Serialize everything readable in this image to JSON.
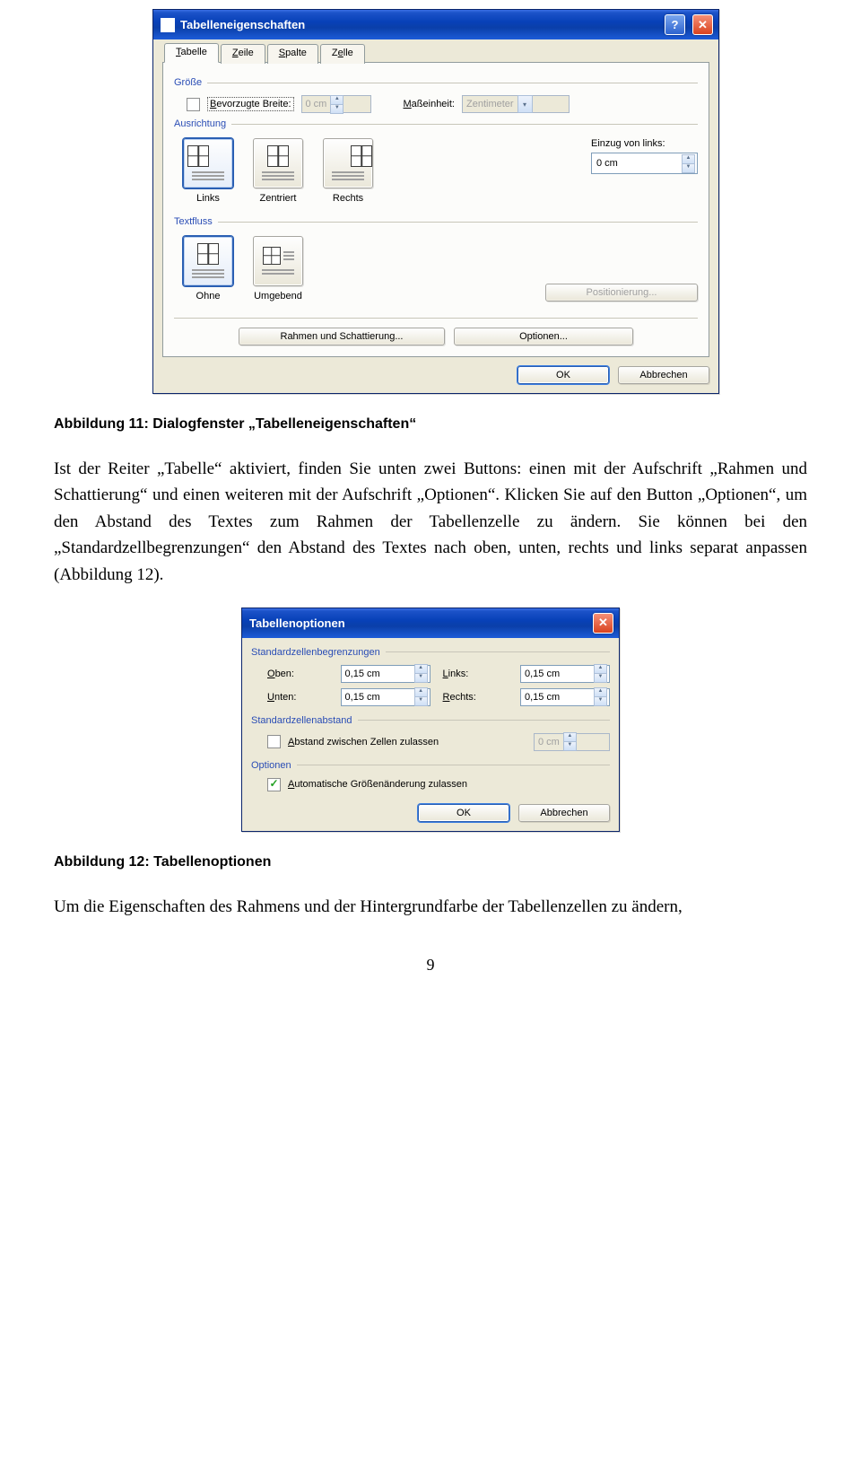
{
  "dialog1": {
    "title": "Tabelleneigenschaften",
    "tabs": [
      "Tabelle",
      "Zeile",
      "Spalte",
      "Zelle"
    ],
    "size": {
      "group_label": "Größe",
      "checkbox_label_pre": "B",
      "checkbox_label_rest": "evorzugte Breite:",
      "width_value": "0 cm",
      "unit_label_pre": "M",
      "unit_label_rest": "aßeinheit:",
      "unit_value": "Zentimeter"
    },
    "alignment": {
      "group_label": "Ausrichtung",
      "options": [
        {
          "label_pre": "L",
          "label_rest": "inks"
        },
        {
          "label_pre": "Z",
          "label_rest": "entriert"
        },
        {
          "label_pre": "R",
          "label_rest": "echts"
        }
      ],
      "indent_label_pre": "Einzug ",
      "indent_label_ul": "v",
      "indent_label_rest": "on links:",
      "indent_value": "0 cm"
    },
    "wrap": {
      "group_label": "Textfluss",
      "options": [
        {
          "label_pre": "O",
          "label_rest": "hne"
        },
        {
          "label_pre": "U",
          "label_rest": "mgebend"
        }
      ],
      "position_btn": "Positionierung..."
    },
    "buttons": {
      "border_shade": "Rahmen und Schattierung...",
      "options": "Optionen...",
      "ok": "OK",
      "cancel": "Abbrechen"
    }
  },
  "caption1": "Abbildung 11: Dialogfenster „Tabelleneigenschaften“",
  "paragraph1": "Ist der Reiter „Tabelle“ aktiviert, finden Sie unten zwei Buttons: einen mit der Aufschrift „Rahmen und Schattierung“ und einen weiteren mit der Aufschrift „Optionen“. Klicken Sie auf den Button „Optionen“, um den Abstand des Textes zum Rahmen der Tabellenzelle zu ändern. Sie können bei den „Standardzellbegrenzungen“ den Abstand des Textes nach oben, unten, rechts und links separat anpassen (Abbildung 12).",
  "dialog2": {
    "title": "Tabellenoptionen",
    "margins": {
      "group_label": "Standardzellenbegrenzungen",
      "top_label_pre": "O",
      "top_label_rest": "ben:",
      "bottom_label_pre": "U",
      "bottom_label_rest": "nten:",
      "left_label_pre": "L",
      "left_label_rest": "inks:",
      "right_label_pre": "R",
      "right_label_rest": "echts:",
      "top_value": "0,15 cm",
      "bottom_value": "0,15 cm",
      "left_value": "0,15 cm",
      "right_value": "0,15 cm"
    },
    "spacing": {
      "group_label": "Standardzellenabstand",
      "checkbox_label_pre": "A",
      "checkbox_label_rest": "bstand zwischen Zellen zulassen",
      "value": "0 cm"
    },
    "options": {
      "group_label": "Optionen",
      "checkbox_label_pre": "A",
      "checkbox_label_rest": "utomatische Größenänderung zulassen"
    },
    "buttons": {
      "ok": "OK",
      "cancel": "Abbrechen"
    }
  },
  "caption2": "Abbildung 12: Tabellenoptionen",
  "paragraph2": "Um die Eigenschaften des Rahmens und der Hintergrundfarbe der Tabellenzellen zu ändern,",
  "page_number": "9"
}
